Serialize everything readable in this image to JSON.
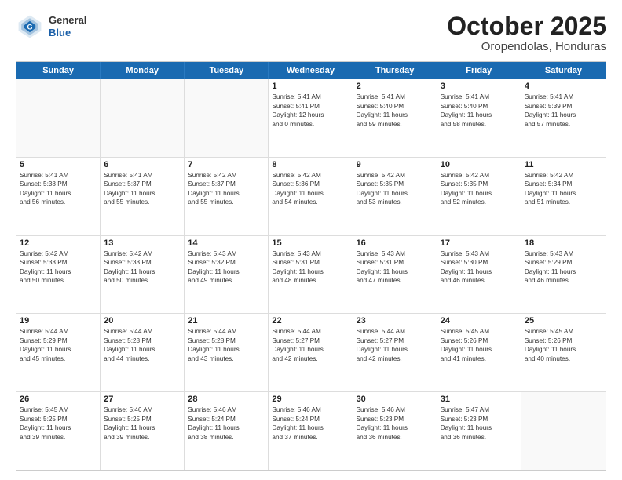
{
  "header": {
    "logo": {
      "general": "General",
      "blue": "Blue"
    },
    "title": "October 2025",
    "subtitle": "Oropendolas, Honduras"
  },
  "weekdays": [
    "Sunday",
    "Monday",
    "Tuesday",
    "Wednesday",
    "Thursday",
    "Friday",
    "Saturday"
  ],
  "weeks": [
    [
      {
        "day": "",
        "lines": []
      },
      {
        "day": "",
        "lines": []
      },
      {
        "day": "",
        "lines": []
      },
      {
        "day": "1",
        "lines": [
          "Sunrise: 5:41 AM",
          "Sunset: 5:41 PM",
          "Daylight: 12 hours",
          "and 0 minutes."
        ]
      },
      {
        "day": "2",
        "lines": [
          "Sunrise: 5:41 AM",
          "Sunset: 5:40 PM",
          "Daylight: 11 hours",
          "and 59 minutes."
        ]
      },
      {
        "day": "3",
        "lines": [
          "Sunrise: 5:41 AM",
          "Sunset: 5:40 PM",
          "Daylight: 11 hours",
          "and 58 minutes."
        ]
      },
      {
        "day": "4",
        "lines": [
          "Sunrise: 5:41 AM",
          "Sunset: 5:39 PM",
          "Daylight: 11 hours",
          "and 57 minutes."
        ]
      }
    ],
    [
      {
        "day": "5",
        "lines": [
          "Sunrise: 5:41 AM",
          "Sunset: 5:38 PM",
          "Daylight: 11 hours",
          "and 56 minutes."
        ]
      },
      {
        "day": "6",
        "lines": [
          "Sunrise: 5:41 AM",
          "Sunset: 5:37 PM",
          "Daylight: 11 hours",
          "and 55 minutes."
        ]
      },
      {
        "day": "7",
        "lines": [
          "Sunrise: 5:42 AM",
          "Sunset: 5:37 PM",
          "Daylight: 11 hours",
          "and 55 minutes."
        ]
      },
      {
        "day": "8",
        "lines": [
          "Sunrise: 5:42 AM",
          "Sunset: 5:36 PM",
          "Daylight: 11 hours",
          "and 54 minutes."
        ]
      },
      {
        "day": "9",
        "lines": [
          "Sunrise: 5:42 AM",
          "Sunset: 5:35 PM",
          "Daylight: 11 hours",
          "and 53 minutes."
        ]
      },
      {
        "day": "10",
        "lines": [
          "Sunrise: 5:42 AM",
          "Sunset: 5:35 PM",
          "Daylight: 11 hours",
          "and 52 minutes."
        ]
      },
      {
        "day": "11",
        "lines": [
          "Sunrise: 5:42 AM",
          "Sunset: 5:34 PM",
          "Daylight: 11 hours",
          "and 51 minutes."
        ]
      }
    ],
    [
      {
        "day": "12",
        "lines": [
          "Sunrise: 5:42 AM",
          "Sunset: 5:33 PM",
          "Daylight: 11 hours",
          "and 50 minutes."
        ]
      },
      {
        "day": "13",
        "lines": [
          "Sunrise: 5:42 AM",
          "Sunset: 5:33 PM",
          "Daylight: 11 hours",
          "and 50 minutes."
        ]
      },
      {
        "day": "14",
        "lines": [
          "Sunrise: 5:43 AM",
          "Sunset: 5:32 PM",
          "Daylight: 11 hours",
          "and 49 minutes."
        ]
      },
      {
        "day": "15",
        "lines": [
          "Sunrise: 5:43 AM",
          "Sunset: 5:31 PM",
          "Daylight: 11 hours",
          "and 48 minutes."
        ]
      },
      {
        "day": "16",
        "lines": [
          "Sunrise: 5:43 AM",
          "Sunset: 5:31 PM",
          "Daylight: 11 hours",
          "and 47 minutes."
        ]
      },
      {
        "day": "17",
        "lines": [
          "Sunrise: 5:43 AM",
          "Sunset: 5:30 PM",
          "Daylight: 11 hours",
          "and 46 minutes."
        ]
      },
      {
        "day": "18",
        "lines": [
          "Sunrise: 5:43 AM",
          "Sunset: 5:29 PM",
          "Daylight: 11 hours",
          "and 46 minutes."
        ]
      }
    ],
    [
      {
        "day": "19",
        "lines": [
          "Sunrise: 5:44 AM",
          "Sunset: 5:29 PM",
          "Daylight: 11 hours",
          "and 45 minutes."
        ]
      },
      {
        "day": "20",
        "lines": [
          "Sunrise: 5:44 AM",
          "Sunset: 5:28 PM",
          "Daylight: 11 hours",
          "and 44 minutes."
        ]
      },
      {
        "day": "21",
        "lines": [
          "Sunrise: 5:44 AM",
          "Sunset: 5:28 PM",
          "Daylight: 11 hours",
          "and 43 minutes."
        ]
      },
      {
        "day": "22",
        "lines": [
          "Sunrise: 5:44 AM",
          "Sunset: 5:27 PM",
          "Daylight: 11 hours",
          "and 42 minutes."
        ]
      },
      {
        "day": "23",
        "lines": [
          "Sunrise: 5:44 AM",
          "Sunset: 5:27 PM",
          "Daylight: 11 hours",
          "and 42 minutes."
        ]
      },
      {
        "day": "24",
        "lines": [
          "Sunrise: 5:45 AM",
          "Sunset: 5:26 PM",
          "Daylight: 11 hours",
          "and 41 minutes."
        ]
      },
      {
        "day": "25",
        "lines": [
          "Sunrise: 5:45 AM",
          "Sunset: 5:26 PM",
          "Daylight: 11 hours",
          "and 40 minutes."
        ]
      }
    ],
    [
      {
        "day": "26",
        "lines": [
          "Sunrise: 5:45 AM",
          "Sunset: 5:25 PM",
          "Daylight: 11 hours",
          "and 39 minutes."
        ]
      },
      {
        "day": "27",
        "lines": [
          "Sunrise: 5:46 AM",
          "Sunset: 5:25 PM",
          "Daylight: 11 hours",
          "and 39 minutes."
        ]
      },
      {
        "day": "28",
        "lines": [
          "Sunrise: 5:46 AM",
          "Sunset: 5:24 PM",
          "Daylight: 11 hours",
          "and 38 minutes."
        ]
      },
      {
        "day": "29",
        "lines": [
          "Sunrise: 5:46 AM",
          "Sunset: 5:24 PM",
          "Daylight: 11 hours",
          "and 37 minutes."
        ]
      },
      {
        "day": "30",
        "lines": [
          "Sunrise: 5:46 AM",
          "Sunset: 5:23 PM",
          "Daylight: 11 hours",
          "and 36 minutes."
        ]
      },
      {
        "day": "31",
        "lines": [
          "Sunrise: 5:47 AM",
          "Sunset: 5:23 PM",
          "Daylight: 11 hours",
          "and 36 minutes."
        ]
      },
      {
        "day": "",
        "lines": []
      }
    ]
  ]
}
